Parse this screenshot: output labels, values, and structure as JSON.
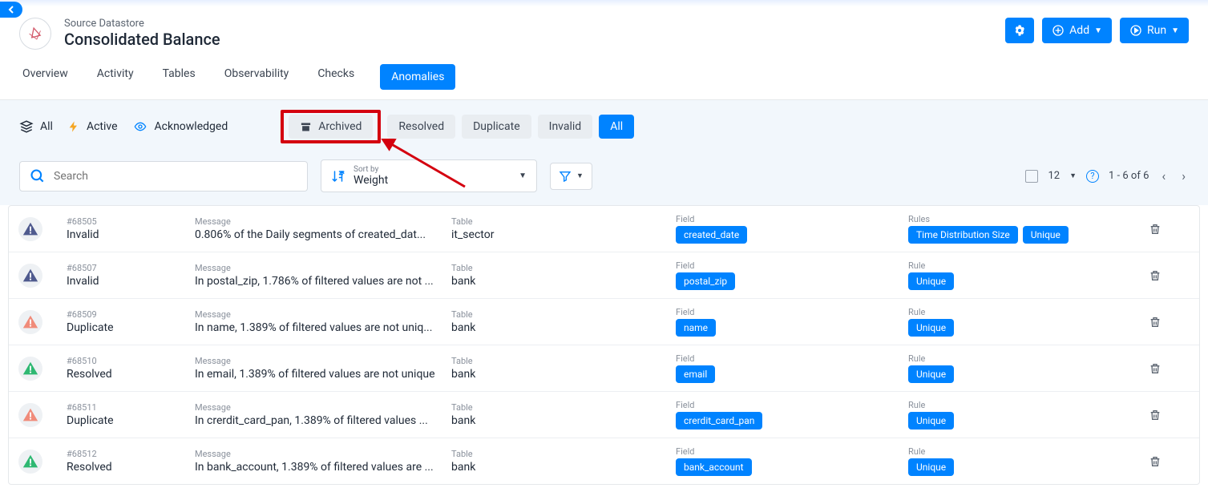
{
  "header": {
    "subtitle": "Source Datastore",
    "title": "Consolidated Balance",
    "add_label": "Add",
    "run_label": "Run"
  },
  "tabs": [
    "Overview",
    "Activity",
    "Tables",
    "Observability",
    "Checks",
    "Anomalies"
  ],
  "active_tab": 5,
  "status_filters": {
    "all": "All",
    "active": "Active",
    "acknowledged": "Acknowledged"
  },
  "pill_filters": {
    "archived": "Archived",
    "resolved": "Resolved",
    "duplicate": "Duplicate",
    "invalid": "Invalid",
    "all": "All"
  },
  "search": {
    "placeholder": "Search"
  },
  "sort": {
    "label": "Sort by",
    "value": "Weight"
  },
  "pager": {
    "page_size": "12",
    "range": "1 - 6 of 6"
  },
  "column_labels": {
    "message": "Message",
    "table": "Table",
    "field": "Field",
    "rule": "Rule",
    "rules": "Rules"
  },
  "rows": [
    {
      "id": "#68505",
      "status": "Invalid",
      "color": "#4f5a8e",
      "message": "0.806% of the Daily segments of created_dat...",
      "table": "it_sector",
      "field_chips": [
        "created_date"
      ],
      "rule_chips": [
        "Time Distribution Size",
        "Unique"
      ],
      "rule_label": "Rules"
    },
    {
      "id": "#68507",
      "status": "Invalid",
      "color": "#4f5a8e",
      "message": "In postal_zip, 1.786% of filtered values are not ...",
      "table": "bank",
      "field_chips": [
        "postal_zip"
      ],
      "rule_chips": [
        "Unique"
      ],
      "rule_label": "Rule"
    },
    {
      "id": "#68509",
      "status": "Duplicate",
      "color": "#f08b7a",
      "message": "In name, 1.389% of filtered values are not uniq...",
      "table": "bank",
      "field_chips": [
        "name"
      ],
      "rule_chips": [
        "Unique"
      ],
      "rule_label": "Rule"
    },
    {
      "id": "#68510",
      "status": "Resolved",
      "color": "#2eb872",
      "message": "In email, 1.389% of filtered values are not unique",
      "table": "bank",
      "field_chips": [
        "email"
      ],
      "rule_chips": [
        "Unique"
      ],
      "rule_label": "Rule"
    },
    {
      "id": "#68511",
      "status": "Duplicate",
      "color": "#f08b7a",
      "message": "In crerdit_card_pan, 1.389% of filtered values ...",
      "table": "bank",
      "field_chips": [
        "crerdit_card_pan"
      ],
      "rule_chips": [
        "Unique"
      ],
      "rule_label": "Rule"
    },
    {
      "id": "#68512",
      "status": "Resolved",
      "color": "#2eb872",
      "message": "In bank_account, 1.389% of filtered values are ...",
      "table": "bank",
      "field_chips": [
        "bank_account"
      ],
      "rule_chips": [
        "Unique"
      ],
      "rule_label": "Rule"
    }
  ]
}
